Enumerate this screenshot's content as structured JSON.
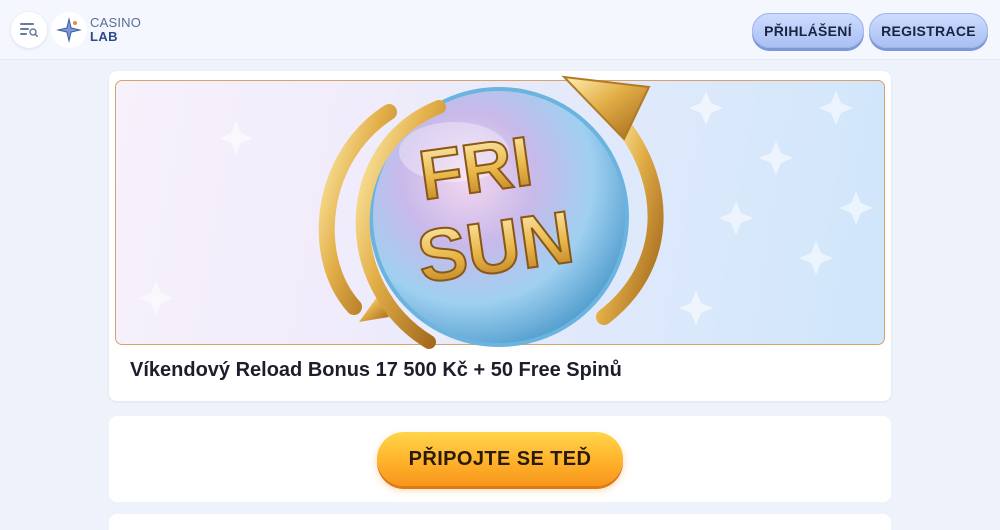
{
  "header": {
    "logo": {
      "line1": "CASINO",
      "line2": "LAB"
    },
    "login_label": "PŘIHLÁŠENÍ",
    "register_label": "REGISTRACE"
  },
  "promo": {
    "banner_text_line1": "FRI",
    "banner_text_line2": "SUN",
    "title": "Víkendový Reload Bonus 17 500 Kč + 50 Free Spinů"
  },
  "cta": {
    "label": "PŘIPOJTE SE TEĎ"
  },
  "icons": [
    "menu-search-icon",
    "star-logo-icon"
  ],
  "colors": {
    "accent_blue": "#b4c8f6",
    "cta_orange": "#ffb22b",
    "gold": "#d9a545",
    "text_dark": "#1c1f2b"
  }
}
